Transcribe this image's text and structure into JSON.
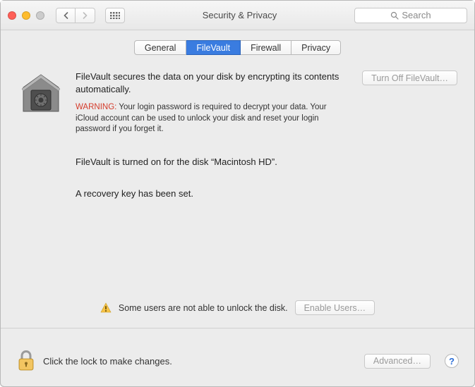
{
  "window": {
    "title": "Security & Privacy"
  },
  "search": {
    "placeholder": "Search"
  },
  "tabs": {
    "general": "General",
    "filevault": "FileVault",
    "firewall": "Firewall",
    "privacy": "Privacy"
  },
  "main": {
    "intro": "FileVault secures the data on your disk by encrypting its contents automatically.",
    "turn_off_label": "Turn Off FileVault…",
    "warning_label": "WARNING:",
    "warning_text": " Your login password is required to decrypt your data. Your iCloud account can be used to unlock your disk and reset your login password if you forget it.",
    "status_on": "FileVault is turned on for the disk “Macintosh HD”.",
    "recovery_set": "A recovery key has been set.",
    "enable_users_msg": "Some users are not able to unlock the disk.",
    "enable_users_label": "Enable Users…"
  },
  "footer": {
    "lock_msg": "Click the lock to make changes.",
    "advanced_label": "Advanced…",
    "help_label": "?"
  }
}
